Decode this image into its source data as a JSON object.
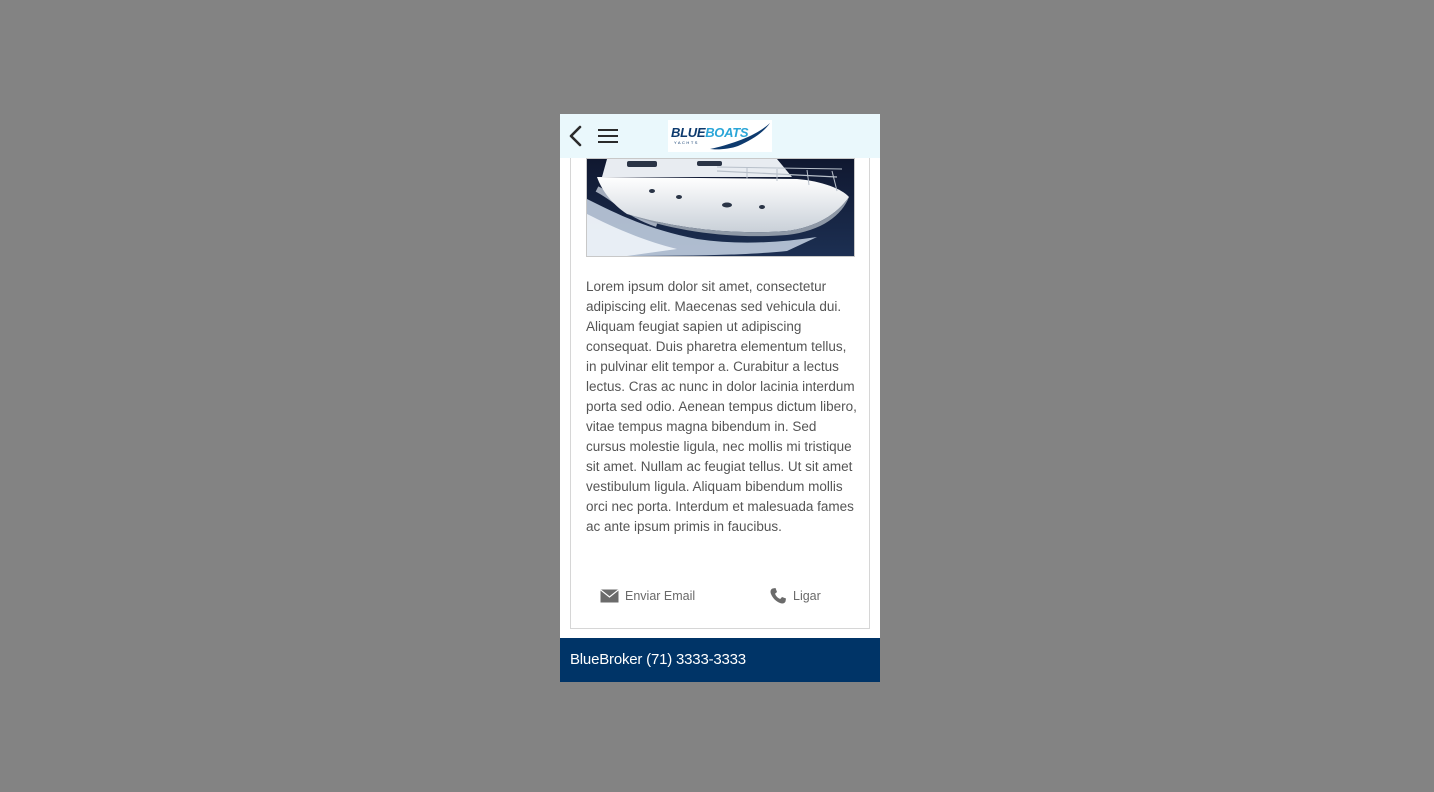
{
  "header": {
    "back_icon": "chevron-left-icon",
    "menu_icon": "hamburger-menu-icon",
    "logo": {
      "part1": "BLUE",
      "part2": "BOATS",
      "sub": "YACHTS"
    }
  },
  "content": {
    "image": "speedboat-photo",
    "description": "Lorem ipsum dolor sit amet, consectetur adipiscing elit. Maecenas sed vehicula dui. Aliquam feugiat sapien ut adipiscing consequat. Duis pharetra elementum tellus, in pulvinar elit tempor a. Curabitur a lectus lectus. Cras ac nunc in dolor lacinia interdum porta sed odio. Aenean tempus dictum libero, vitae tempus magna bibendum in. Sed cursus molestie ligula, nec mollis mi tristique sit amet. Nullam ac feugiat tellus. Ut sit amet vestibulum ligula. Aliquam bibendum mollis orci nec porta. Interdum et malesuada fames ac ante ipsum primis in faucibus."
  },
  "actions": {
    "email_label": "Enviar Email",
    "email_icon": "envelope-icon",
    "call_label": "Ligar",
    "call_icon": "phone-icon"
  },
  "footer": {
    "text": "BlueBroker (71) 3333-3333"
  },
  "colors": {
    "page_bg": "#838383",
    "header_bg": "#eaf8fc",
    "footer_bg": "#003467",
    "text": "#555555",
    "logo_dark": "#0d3a6e",
    "logo_light": "#2ba6d8"
  }
}
